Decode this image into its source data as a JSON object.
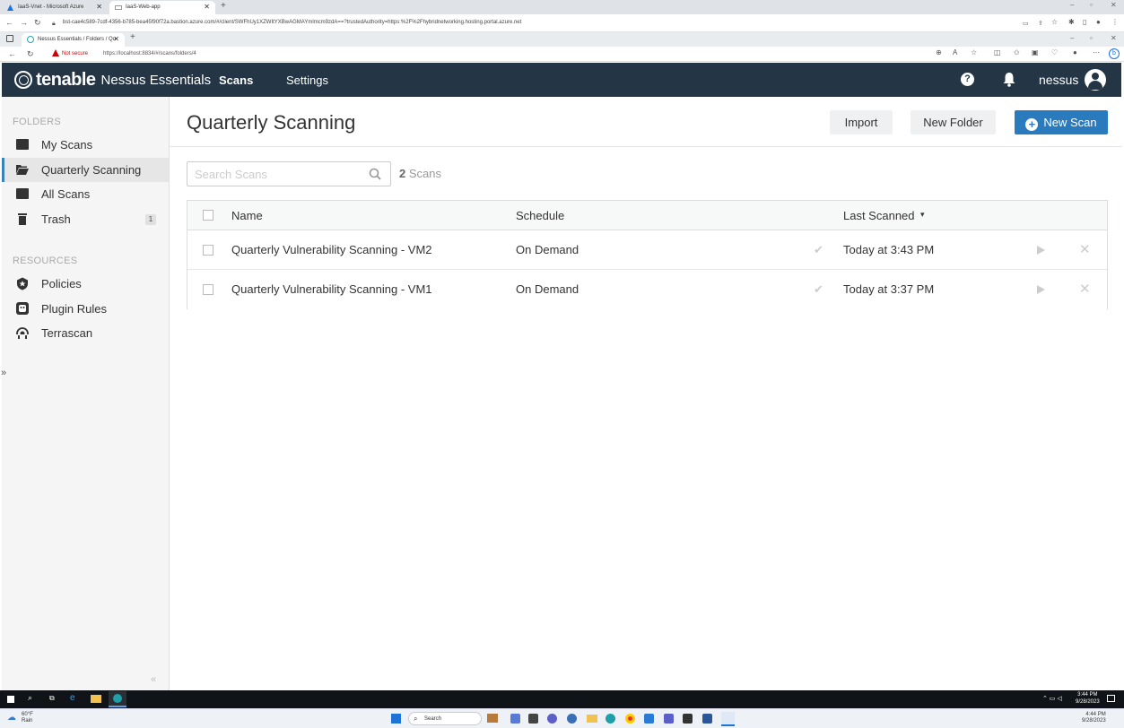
{
  "outer_browser": {
    "tabs": [
      {
        "label": "IaaS-Vnet - Microsoft Azure"
      },
      {
        "label": "IaaS-Web-app"
      }
    ],
    "url": "bst-cae4c589-7cdf-4356-b785-bea45f90f72a.bastion.azure.com/#/client/SWFhUy1XZWItYXBwAGMAYmlmcm9zdA==?trustedAuthority=https:%2F%2Fhybridnetworking.hosting.portal.azure.net"
  },
  "inner_browser": {
    "tab_label": "Nessus Essentials / Folders / Qu",
    "security_label": "Not secure",
    "url": "https://localhost:8834/#/scans/folders/4"
  },
  "header": {
    "brand": "tenable",
    "product": "Nessus Essentials",
    "nav": [
      {
        "label": "Scans"
      },
      {
        "label": "Settings"
      }
    ],
    "help_glyph": "?",
    "user": "nessus"
  },
  "sidebar": {
    "folders_heading": "FOLDERS",
    "folders": [
      {
        "label": "My Scans",
        "icon": "folder-icon"
      },
      {
        "label": "Quarterly Scanning",
        "icon": "folder-open-icon"
      },
      {
        "label": "All Scans",
        "icon": "folder-icon"
      },
      {
        "label": "Trash",
        "icon": "trash-icon",
        "badge": "1"
      }
    ],
    "resources_heading": "RESOURCES",
    "resources": [
      {
        "label": "Policies",
        "icon": "shield-icon"
      },
      {
        "label": "Plugin Rules",
        "icon": "plugin-icon"
      },
      {
        "label": "Terrascan",
        "icon": "terrascan-icon"
      }
    ],
    "collapse_glyph": "«",
    "expand_glyph": "»"
  },
  "main": {
    "title": "Quarterly Scanning",
    "buttons": {
      "import": "Import",
      "new_folder": "New Folder",
      "new_scan": "New Scan"
    },
    "search_placeholder": "Search Scans",
    "scan_count": "2",
    "scan_count_label": "Scans",
    "table": {
      "columns": {
        "name": "Name",
        "schedule": "Schedule",
        "last_scanned": "Last Scanned"
      },
      "sort_glyph": "▾",
      "rows": [
        {
          "name": "Quarterly Vulnerability Scanning - VM2",
          "schedule": "On Demand",
          "last_scanned": "Today at 3:43 PM"
        },
        {
          "name": "Quarterly Vulnerability Scanning - VM1",
          "schedule": "On Demand",
          "last_scanned": "Today at 3:37 PM"
        }
      ],
      "check_glyph": "✔",
      "delete_glyph": "✕"
    }
  },
  "taskbar_inner": {
    "time": "3:44 PM",
    "date": "9/28/2023"
  },
  "taskbar_outer": {
    "weather_temp": "60°F",
    "weather_desc": "Rain",
    "search_label": "Search",
    "time": "4:44 PM",
    "date": "9/28/2023"
  },
  "colors": {
    "header_bg": "#243545",
    "accent": "#2a7bbd",
    "sidebar_bg": "#f5f5f5"
  }
}
